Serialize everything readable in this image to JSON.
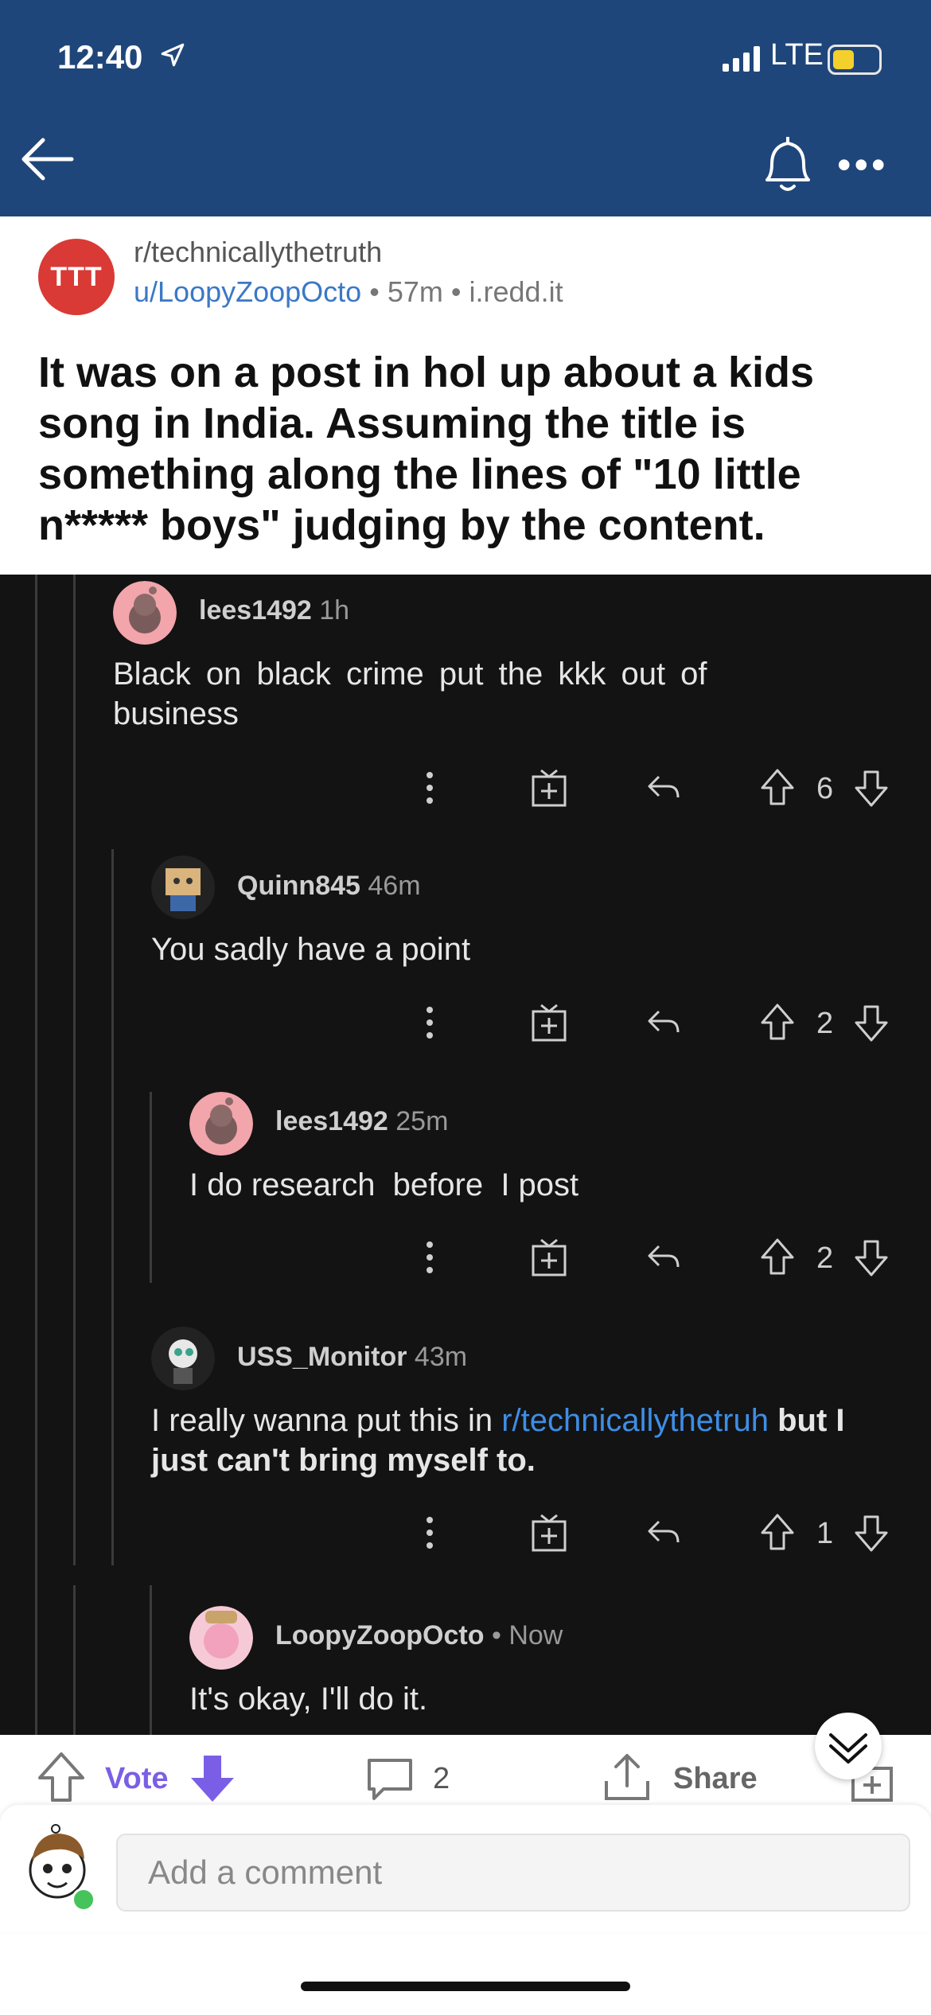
{
  "status_bar": {
    "time": "12:40",
    "network": "LTE"
  },
  "post": {
    "subreddit": "r/technicallythetruth",
    "subreddit_avatar_text": "TTT",
    "author": "u/LoopyZoopOcto",
    "age": "57m",
    "domain": "i.redd.it",
    "separator": "•",
    "title": "It was on a post in hol up about a kids song in India. Assuming the title is something along the lines of \"10 little n***** boys\" judging by the content."
  },
  "comments": [
    {
      "user": "lees1492",
      "age": "1h",
      "body": "Black on black crime put the kkk out of business",
      "votes": "6"
    },
    {
      "user": "Quinn845",
      "age": "46m",
      "body": "You sadly have a point",
      "votes": "2"
    },
    {
      "user": "lees1492",
      "age": "25m",
      "body": "I do research  before  I post",
      "votes": "2"
    },
    {
      "user": "USS_Monitor",
      "age": "43m",
      "body_pre": "I really wanna put this in ",
      "body_link": "r/technicallythetruh",
      "body_post": " but I just can't bring myself to.",
      "votes": "1"
    },
    {
      "user": "LoopyZoopOcto",
      "age": "• Now",
      "body": "It's okay, I'll do it."
    }
  ],
  "bottom_bar": {
    "vote_label": "Vote",
    "comment_count": "2",
    "share_label": "Share"
  },
  "comment_input": {
    "placeholder": "Add a comment"
  },
  "colors": {
    "header_bg": "#1f467a",
    "dark_bg": "#131313",
    "link": "#3d8ee6",
    "vote_accent": "#7a5fe6"
  }
}
